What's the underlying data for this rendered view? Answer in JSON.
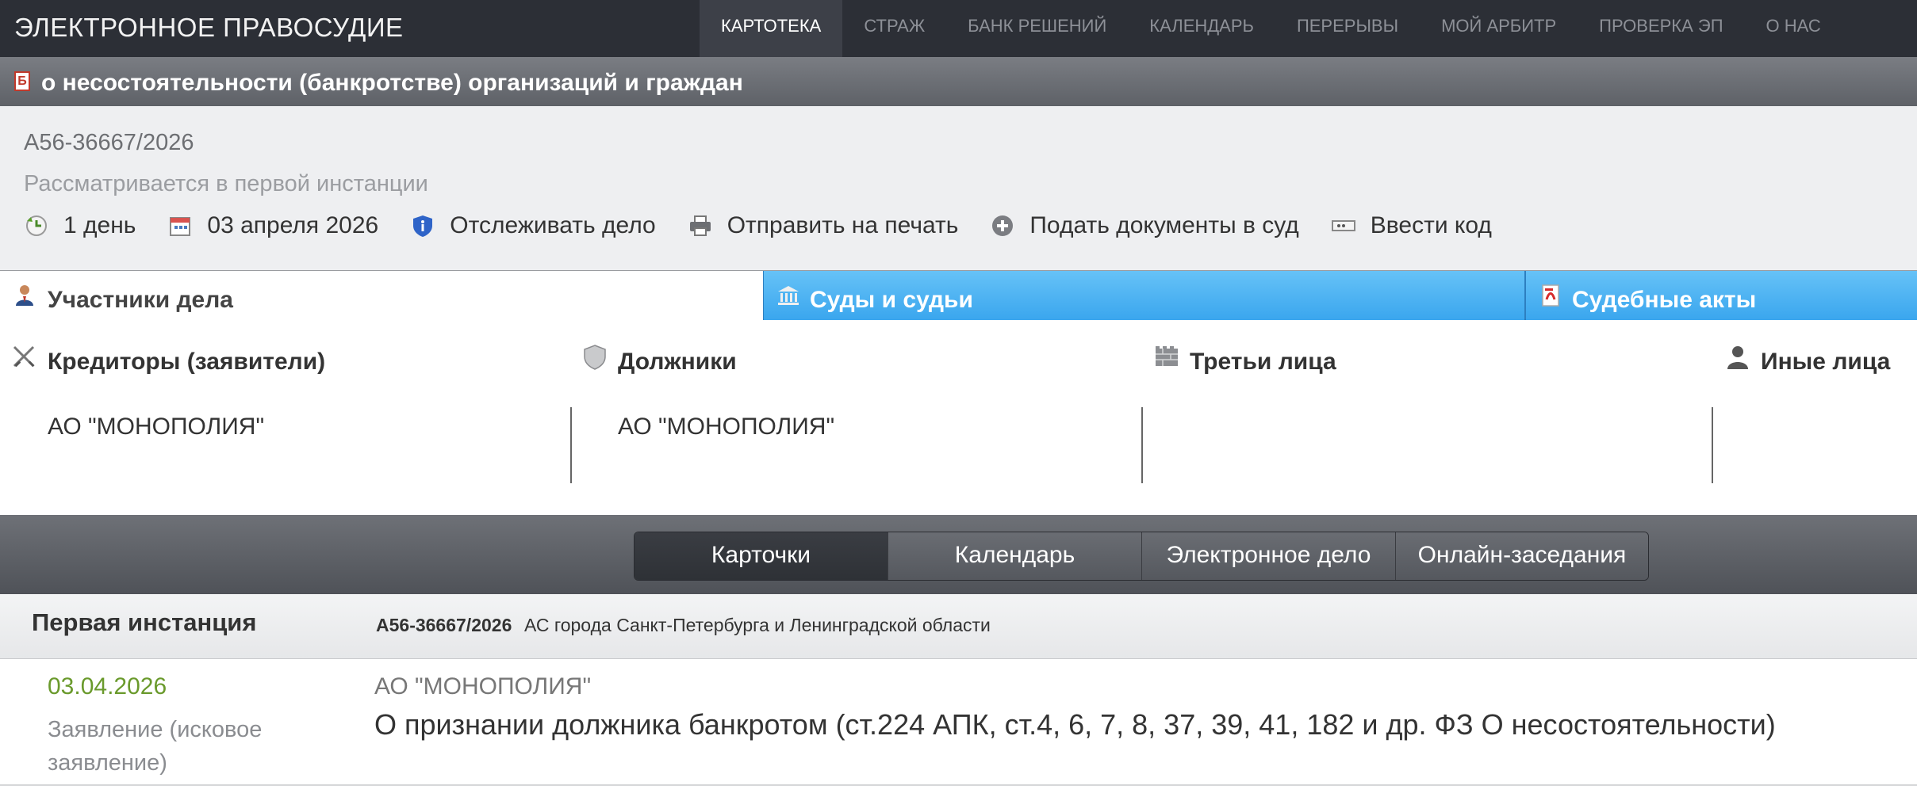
{
  "header": {
    "brand": "ЭЛЕКТРОННОЕ ПРАВОСУДИЕ",
    "nav": [
      "КАРТОТЕКА",
      "СТРАЖ",
      "БАНК РЕШЕНИЙ",
      "КАЛЕНДАРЬ",
      "ПЕРЕРЫВЫ",
      "МОЙ АРБИТР",
      "ПРОВЕРКА ЭП",
      "О НАС"
    ],
    "active_nav": "КАРТОТЕКА"
  },
  "category": {
    "icon_letter": "Б",
    "title": "о несостоятельности (банкротстве) организаций и граждан"
  },
  "case": {
    "number": "А56-36667/2026",
    "status": "Рассматривается в первой инстанции",
    "actions": [
      {
        "icon": "clock-icon",
        "label": "1 день"
      },
      {
        "icon": "calendar-icon",
        "label": "03 апреля 2026"
      },
      {
        "icon": "shield-info-icon",
        "label": "Отслеживать дело"
      },
      {
        "icon": "printer-icon",
        "label": "Отправить на печать"
      },
      {
        "icon": "plus-circle-icon",
        "label": "Подать документы в суд"
      },
      {
        "icon": "code-card-icon",
        "label": "Ввести код"
      }
    ]
  },
  "tabs": {
    "participants": "Участники дела",
    "courts": "Суды и судьи",
    "acts": "Судебные акты"
  },
  "participants": {
    "creditors": {
      "title": "Кредиторы (заявители)",
      "value": "АО \"МОНОПОЛИЯ\""
    },
    "debtors": {
      "title": "Должники",
      "value": "АО \"МОНОПОЛИЯ\""
    },
    "third": {
      "title": "Третьи лица",
      "value": ""
    },
    "others": {
      "title": "Иные лица",
      "value": ""
    }
  },
  "subtabs": [
    "Карточки",
    "Календарь",
    "Электронное дело",
    "Онлайн-заседания"
  ],
  "instance": {
    "title": "Первая инстанция",
    "case_number": "А56-36667/2026",
    "court": "АС города Санкт-Петербурга и Ленинградской области"
  },
  "event": {
    "date": "03.04.2026",
    "type": "Заявление (исковое заявление)",
    "party": "АО \"МОНОПОЛИЯ\"",
    "description": "О признании должника банкротом (ст.224 АПК, ст.4, 6, 7, 8, 37, 39, 41, 182 и др. ФЗ О несостоятельности)"
  },
  "colors": {
    "topbar": "#2c2f36",
    "tab_blue": "#3aa6ee",
    "date_green": "#6a9a2c"
  }
}
